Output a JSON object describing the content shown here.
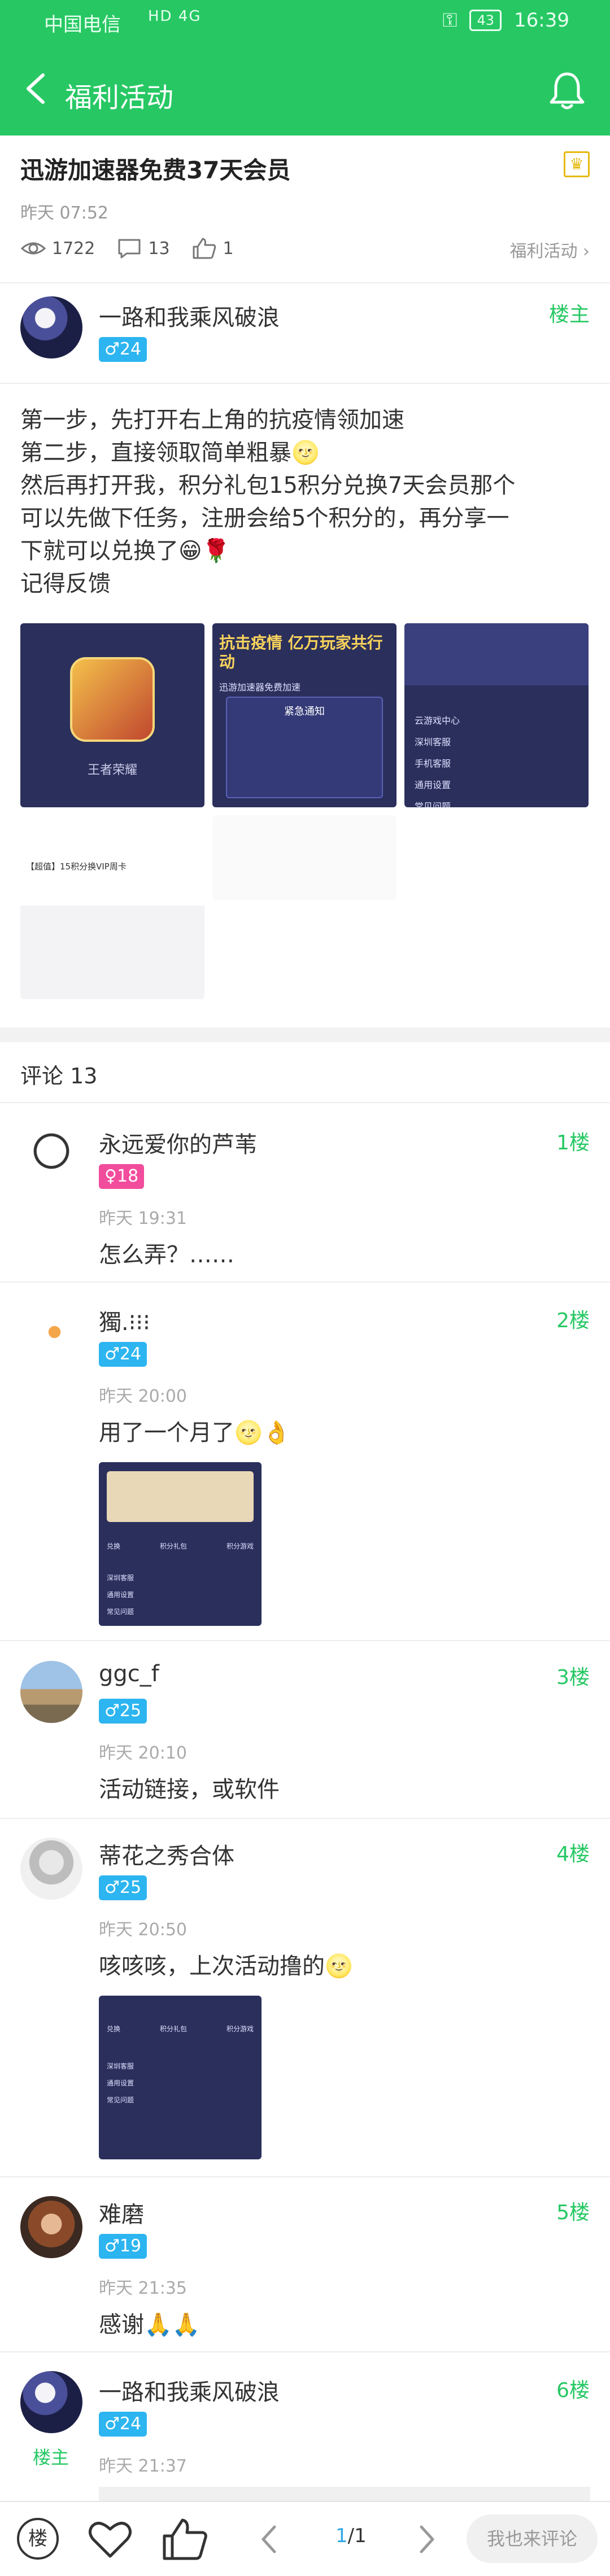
{
  "status_bar": {
    "carrier": "中国电信",
    "signal": "HD 4G",
    "battery": "43",
    "time": "16:39"
  },
  "header": {
    "title": "福利活动"
  },
  "post": {
    "title": "迅游加速器免费37天会员",
    "time": "昨天 07:52",
    "views": "1722",
    "comments": "13",
    "likes": "1",
    "category": "福利活动",
    "author": {
      "name": "一路和我乘风破浪",
      "gender": "♂",
      "level": "24",
      "tag": "楼主"
    },
    "content": [
      "第一步，先打开右上角的抗疫情领加速",
      "第二步，直接领取简单粗暴🌝",
      "然后再打开我，积分礼包15积分兑换7天会员那个",
      "可以先做下任务，注册会给5个积分的，再分享一",
      "下就可以兑换了😁🌹",
      "记得反馈"
    ],
    "image_texts": {
      "img1_label": "王者荣耀",
      "img2_title": "抗击疫情 亿万玩家共行动",
      "img2_sub": "迅游加速器免费加速",
      "img2_notice": "紧急通知",
      "img3_items": [
        "云游戏中心",
        "深圳客服",
        "手机客服",
        "通用设置",
        "常见问题"
      ],
      "img4_label": "【超值】15积分换VIP周卡"
    }
  },
  "comments": {
    "title": "评论 13",
    "items": [
      {
        "name": "永远爱你的芦苇",
        "gender": "♀",
        "level": "18",
        "floor": "1楼",
        "time": "昨天 19:31",
        "text": "怎么弄？……"
      },
      {
        "name": "獨.⁝⁝⁝",
        "gender": "♂",
        "level": "24",
        "floor": "2楼",
        "time": "昨天 20:00",
        "text": "用了一个月了🌝👌"
      },
      {
        "name": "ggc_f",
        "gender": "♂",
        "level": "25",
        "floor": "3楼",
        "time": "昨天 20:10",
        "text": "活动链接，或软件"
      },
      {
        "name": "蒂花之秀合体",
        "gender": "♂",
        "level": "25",
        "floor": "4楼",
        "time": "昨天 20:50",
        "text": "咳咳咳，上次活动撸的🌝"
      },
      {
        "name": "难磨",
        "gender": "♂",
        "level": "19",
        "floor": "5楼",
        "time": "昨天 21:35",
        "text": "感谢🙏🙏"
      },
      {
        "name": "一路和我乘风破浪",
        "gender": "♂",
        "level": "24",
        "floor": "6楼",
        "tag": "楼主",
        "time": "昨天 21:37"
      }
    ],
    "shot_texts": {
      "row1": [
        "兑换",
        "积分礼包",
        "积分游戏"
      ],
      "rows": [
        "深圳客服",
        "通用设置",
        "常见问题"
      ]
    }
  },
  "bottom_bar": {
    "floor_icon": "楼",
    "page_current": "1",
    "page_total": "/1",
    "reply_placeholder": "我也来评论"
  },
  "colors": {
    "brand": "#27c864",
    "male": "#2cb5f0",
    "female": "#f24c9d",
    "crown": "#e5b90f"
  },
  "icons": [
    "back-icon",
    "bell-icon",
    "eye-icon",
    "comment-icon",
    "thumb-up-icon",
    "crown-icon",
    "heart-icon",
    "chevron-left-icon",
    "chevron-right-icon"
  ]
}
